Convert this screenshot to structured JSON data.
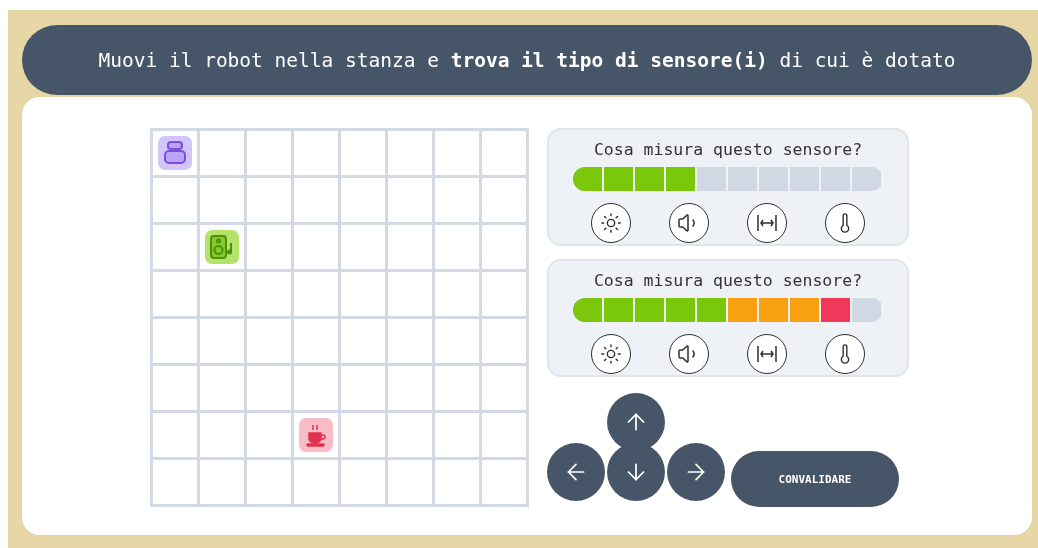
{
  "instruction": "Muovi il robot nella stanza e **trova il tipo di sensore(i)** di cui è dotato",
  "room": {
    "rows": [
      [
        {
          "kind": "robot"
        },
        {
          "kind": "floor"
        },
        {
          "kind": "floor"
        },
        {
          "kind": "floor"
        },
        {
          "kind": "floor"
        },
        {
          "kind": "floor"
        },
        {
          "kind": "floor"
        },
        {
          "kind": "floor"
        }
      ],
      [
        {
          "kind": "floor"
        },
        {
          "kind": "floor"
        },
        {
          "kind": "floor"
        },
        {
          "kind": "floor"
        },
        {
          "kind": "floor"
        },
        {
          "kind": "floor"
        },
        {
          "kind": "floor"
        },
        {
          "kind": "floor"
        }
      ],
      [
        {
          "kind": "floor"
        },
        {
          "kind": "speaker"
        },
        {
          "kind": "floor"
        },
        {
          "kind": "floor"
        },
        {
          "kind": "floor"
        },
        {
          "kind": "floor"
        },
        {
          "kind": "floor"
        },
        {
          "kind": "floor"
        }
      ],
      [
        {
          "kind": "floor"
        },
        {
          "kind": "floor"
        },
        {
          "kind": "floor"
        },
        {
          "kind": "floor"
        },
        {
          "kind": "floor"
        },
        {
          "kind": "floor"
        },
        {
          "kind": "floor"
        },
        {
          "kind": "floor"
        }
      ],
      [
        {
          "kind": "floor"
        },
        {
          "kind": "floor"
        },
        {
          "kind": "floor"
        },
        {
          "kind": "floor"
        },
        {
          "kind": "floor"
        },
        {
          "kind": "floor"
        },
        {
          "kind": "floor"
        },
        {
          "kind": "floor"
        }
      ],
      [
        {
          "kind": "floor"
        },
        {
          "kind": "floor"
        },
        {
          "kind": "floor"
        },
        {
          "kind": "floor"
        },
        {
          "kind": "floor"
        },
        {
          "kind": "floor"
        },
        {
          "kind": "floor"
        },
        {
          "kind": "floor"
        }
      ],
      [
        {
          "kind": "floor"
        },
        {
          "kind": "floor"
        },
        {
          "kind": "floor"
        },
        {
          "kind": "cup"
        },
        {
          "kind": "floor"
        },
        {
          "kind": "floor"
        },
        {
          "kind": "floor"
        },
        {
          "kind": "floor"
        }
      ],
      [
        {
          "kind": "floor"
        },
        {
          "kind": "floor"
        },
        {
          "kind": "floor"
        },
        {
          "kind": "floor"
        },
        {
          "kind": "floor"
        },
        {
          "kind": "floor"
        },
        {
          "kind": "floor"
        },
        {
          "kind": "floor"
        }
      ]
    ]
  },
  "sensors": [
    {
      "question": "Cosa misura questo sensore?",
      "level": 0.4,
      "options": [
        {
          "kind": "light"
        },
        {
          "kind": "sound"
        },
        {
          "kind": "distance"
        },
        {
          "kind": "temperature"
        }
      ]
    },
    {
      "question": "Cosa misura questo sensore?",
      "level": 0.9,
      "options": [
        {
          "kind": "light"
        },
        {
          "kind": "sound"
        },
        {
          "kind": "distance"
        },
        {
          "kind": "temperature"
        }
      ]
    }
  ],
  "arrows": [
    {
      "kind": "up"
    },
    {
      "kind": "left"
    },
    {
      "kind": "down"
    },
    {
      "kind": "right"
    }
  ],
  "validate_button": "CONVALIDARE"
}
